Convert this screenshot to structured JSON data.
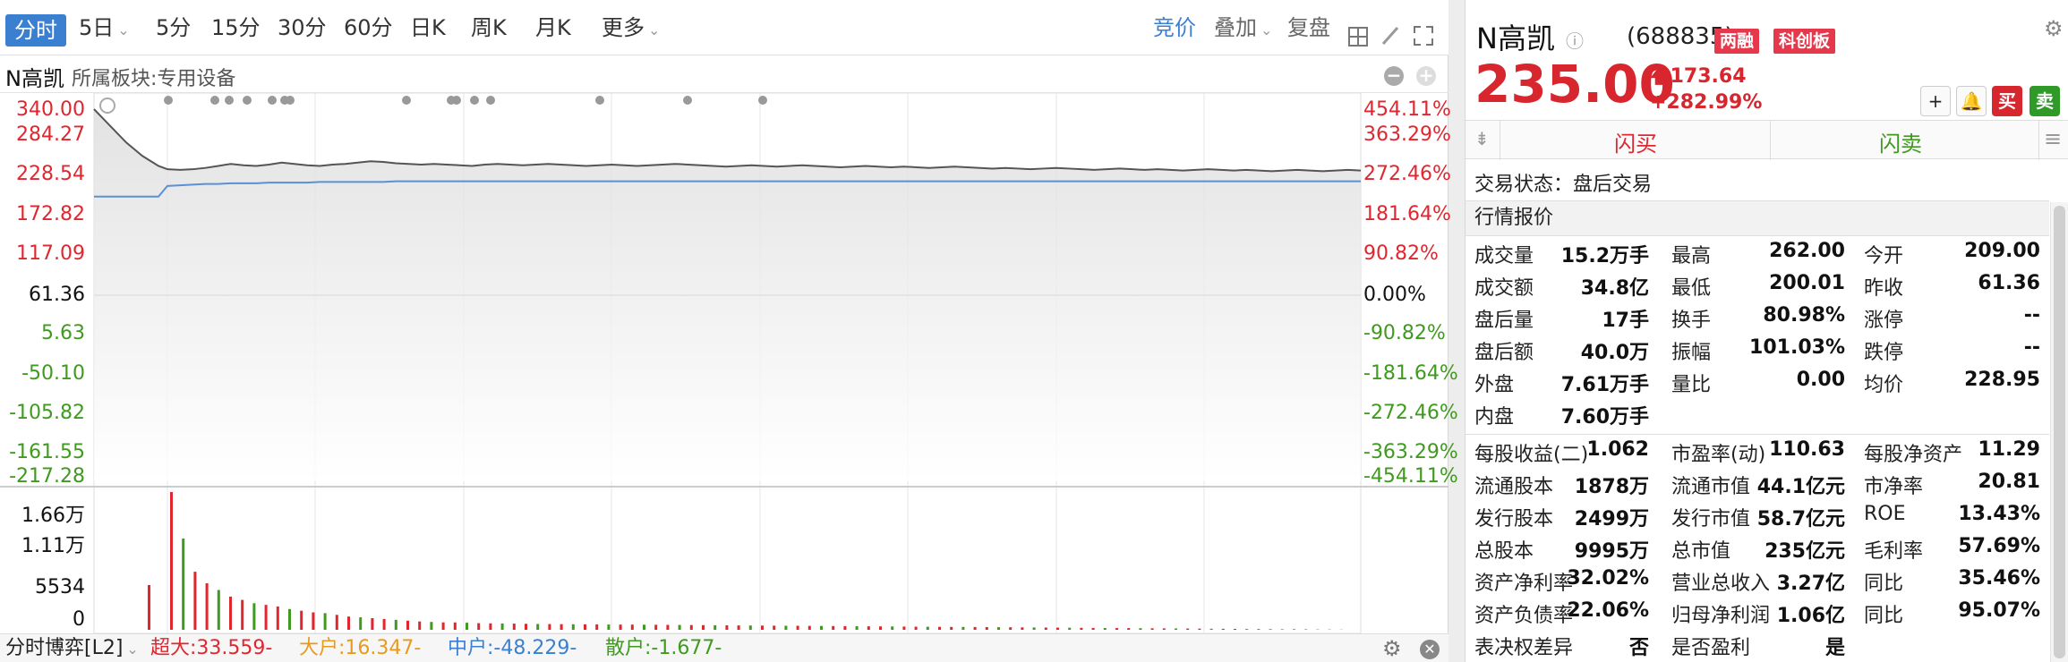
{
  "toolbar": {
    "tabs": [
      "分时",
      "5日",
      "5分",
      "15分",
      "30分",
      "60分",
      "日K",
      "周K",
      "月K",
      "更多"
    ],
    "right_links": [
      "竞价",
      "叠加",
      "复盘"
    ]
  },
  "info": {
    "name": "N高凯",
    "sector": "所属板块:专用设备"
  },
  "axis_left_price": [
    "340.00",
    "284.27",
    "228.54",
    "172.82",
    "117.09",
    "61.36",
    "5.63",
    "-50.10",
    "-105.82",
    "-161.55",
    "-217.28"
  ],
  "axis_right_pct": [
    "454.11%",
    "363.29%",
    "272.46%",
    "181.64%",
    "90.82%",
    "0.00%",
    "-90.82%",
    "-181.64%",
    "-272.46%",
    "-363.29%",
    "-454.11%"
  ],
  "axis_volume": [
    "1.66万",
    "1.11万",
    "5534",
    "0"
  ],
  "bottom": {
    "title": "分时博弈[L2]",
    "super": "超大:33.559-",
    "large": "大户:16.347-",
    "medium": "中户:-48.229-",
    "retail": "散户:-1.677-"
  },
  "stock": {
    "name": "N高凯",
    "code": "(688835)",
    "badge1": "两融",
    "badge2": "科创板",
    "price": "235.00",
    "change": "173.64",
    "change_pct": "+282.99%",
    "buy": "买",
    "sell": "卖",
    "flash_buy": "闪买",
    "flash_sell": "闪卖",
    "trade_status": "交易状态：盘后交易",
    "quote_header": "行情报价"
  },
  "quotes": [
    [
      [
        "成交量",
        "15.2万手",
        "dark"
      ],
      [
        "最高",
        "262.00",
        "red"
      ],
      [
        "今开",
        "209.00",
        "red"
      ]
    ],
    [
      [
        "成交额",
        "34.8亿",
        "dark"
      ],
      [
        "最低",
        "200.01",
        "red"
      ],
      [
        "昨收",
        "61.36",
        "dark"
      ]
    ],
    [
      [
        "盘后量",
        "17手",
        "dark"
      ],
      [
        "换手",
        "80.98%",
        "dark"
      ],
      [
        "涨停",
        "--",
        "dark"
      ]
    ],
    [
      [
        "盘后额",
        "40.0万",
        "dark"
      ],
      [
        "振幅",
        "101.03%",
        "dark"
      ],
      [
        "跌停",
        "--",
        "dark"
      ]
    ],
    [
      [
        "外盘",
        "7.61万手",
        "red"
      ],
      [
        "量比",
        "0.00",
        "dark"
      ],
      [
        "均价",
        "228.95",
        "red"
      ]
    ],
    [
      [
        "内盘",
        "7.60万手",
        "green"
      ],
      [
        "",
        "",
        "dark"
      ],
      [
        "",
        "",
        "dark"
      ]
    ],
    [
      [
        "每股收益(二)",
        "1.062",
        "dark"
      ],
      [
        "市盈率(动)",
        "110.63",
        "dark"
      ],
      [
        "每股净资产",
        "11.29",
        "dark"
      ]
    ],
    [
      [
        "流通股本",
        "1878万",
        "dark"
      ],
      [
        "流通市值",
        "44.1亿元",
        "dark"
      ],
      [
        "市净率",
        "20.81",
        "dark"
      ]
    ],
    [
      [
        "发行股本",
        "2499万",
        "dark"
      ],
      [
        "发行市值",
        "58.7亿元",
        "dark"
      ],
      [
        "ROE",
        "13.43%",
        "dark"
      ]
    ],
    [
      [
        "总股本",
        "9995万",
        "dark"
      ],
      [
        "总市值",
        "235亿元",
        "dark"
      ],
      [
        "毛利率",
        "57.69%",
        "dark"
      ]
    ],
    [
      [
        "资产净利率",
        "32.02%",
        "dark"
      ],
      [
        "营业总收入",
        "3.27亿",
        "dark"
      ],
      [
        "同比",
        "35.46%",
        "dark"
      ]
    ],
    [
      [
        "资产负债率",
        "22.06%",
        "dark"
      ],
      [
        "归母净利润",
        "1.06亿",
        "dark"
      ],
      [
        "同比",
        "95.07%",
        "dark"
      ]
    ],
    [
      [
        "表决权差异",
        "否",
        "dark"
      ],
      [
        "是否盈利",
        "是",
        "dark"
      ],
      [
        "",
        "",
        "dark"
      ]
    ]
  ],
  "chart_data": {
    "type": "line",
    "title": "",
    "series": [
      {
        "values": [
          340,
          315,
          290,
          270,
          255,
          250,
          249,
          250,
          252,
          255,
          258,
          256,
          255,
          257,
          260,
          258,
          256,
          255,
          257,
          258,
          260,
          262,
          261,
          259,
          258,
          257,
          258,
          257,
          256,
          255,
          257,
          258,
          257,
          256,
          257,
          258,
          257,
          256,
          255,
          256,
          257,
          256,
          255,
          256,
          257,
          258,
          257,
          256,
          255,
          254,
          255,
          256,
          255,
          254,
          255,
          256,
          255,
          254,
          253,
          254,
          255,
          254,
          253,
          254,
          253,
          252,
          253,
          254,
          253,
          252,
          251,
          252,
          251,
          250,
          251,
          252,
          251,
          250,
          249,
          250,
          251,
          250,
          249,
          250,
          249,
          248,
          249,
          250,
          249,
          248,
          249,
          248,
          247,
          248,
          249,
          248,
          247,
          248,
          249,
          248
        ]
      },
      {
        "values": [
          209,
          209,
          209,
          209,
          209,
          225,
          226,
          227,
          228,
          228,
          229,
          229,
          229,
          230,
          230,
          230,
          230,
          231,
          231,
          231,
          231,
          231,
          231,
          232,
          232,
          232,
          232,
          232,
          232,
          232,
          232,
          232,
          232,
          232,
          232,
          232,
          232,
          232,
          232,
          232,
          232,
          232,
          232,
          232,
          232,
          232,
          232,
          232,
          232,
          232,
          232,
          232,
          232,
          232,
          232,
          232,
          232,
          232,
          232,
          232,
          232,
          232,
          232,
          232,
          232,
          232,
          232,
          232,
          232,
          232,
          232,
          232,
          232,
          232,
          232,
          232,
          232,
          232,
          232,
          232,
          232,
          232,
          232,
          232,
          232,
          232,
          232,
          232,
          232,
          232,
          232,
          232,
          232,
          232,
          232,
          232,
          232,
          232,
          232,
          232
        ]
      }
    ],
    "ylim": [
      -217.28,
      340.0
    ],
    "base": 61.36,
    "volume": [
      16600,
      11000,
      7000,
      5600,
      4800,
      4000,
      3600,
      3200,
      3000,
      2800,
      2500,
      2300,
      2100,
      2000,
      1800,
      1600,
      1500,
      1400,
      1300,
      1200,
      1100,
      1000,
      950,
      900,
      880,
      850,
      800,
      780,
      760,
      740,
      720,
      700,
      690,
      680,
      670,
      660,
      650,
      640,
      630,
      620,
      610,
      600,
      590,
      580,
      570,
      560,
      550,
      540,
      530,
      520,
      510,
      500,
      490,
      480,
      470,
      460,
      450,
      440,
      430,
      420,
      410,
      400,
      390,
      380,
      370,
      360,
      350,
      340,
      330,
      320,
      310,
      300,
      290,
      280,
      270,
      260,
      250,
      240,
      230,
      220,
      210,
      200,
      190,
      180,
      170,
      160,
      150,
      140,
      130,
      120,
      110,
      100,
      90,
      80,
      70,
      60,
      50,
      40,
      30,
      20
    ],
    "volume_max": 16600,
    "colors": {
      "price": "#555555",
      "avg": "#5b8fd6",
      "up": "#e0262f",
      "down": "#3f9a1f"
    }
  }
}
